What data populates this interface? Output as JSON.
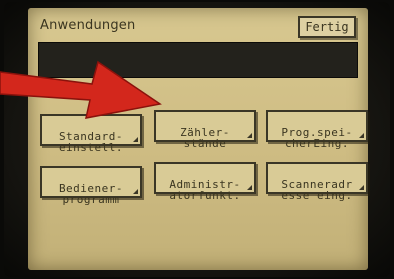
{
  "header": {
    "title": "Anwendungen",
    "done_label": "Fertig"
  },
  "buttons": [
    {
      "label": "Standard-\neinstell."
    },
    {
      "label": "Zähler-\nstände"
    },
    {
      "label": "Prog.spei-\ncherEing."
    },
    {
      "label": "Bediener-\nprogramm"
    },
    {
      "label": "Administr-\natorfunkt."
    },
    {
      "label": "Scanneradr\nesse eing."
    }
  ],
  "colors": {
    "screen": "#cfbd84",
    "ink": "#3a3520",
    "arrow": "#d3271c"
  }
}
